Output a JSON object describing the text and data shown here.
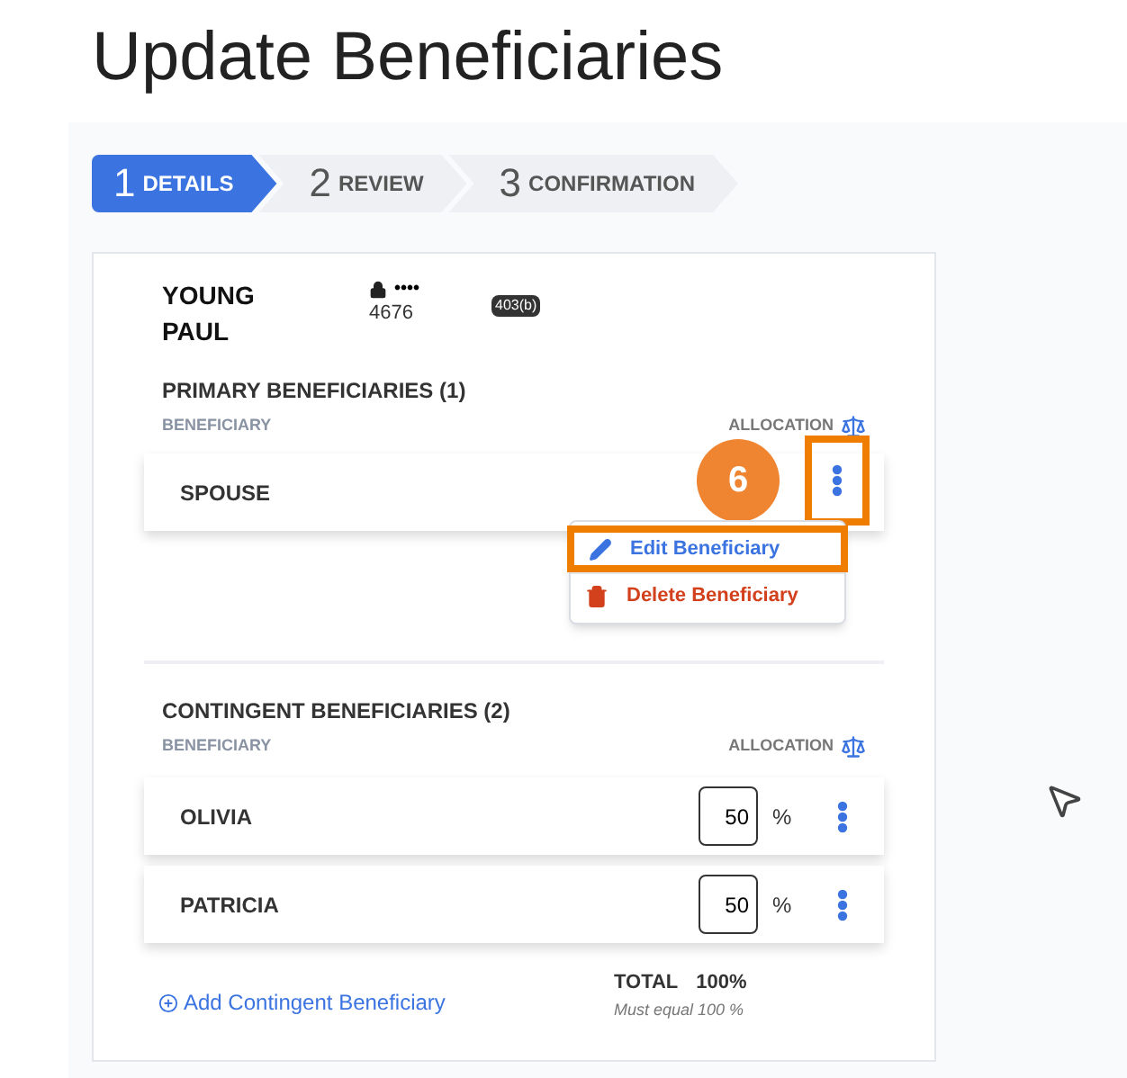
{
  "title": "Update Beneficiaries",
  "steps": [
    {
      "number": "1",
      "label": "DETAILS",
      "selected": true
    },
    {
      "number": "2",
      "label": "REVIEW",
      "selected": false
    },
    {
      "number": "3",
      "label": "CONFIRMATION",
      "selected": false
    }
  ],
  "participant": {
    "last_name": "YOUNG",
    "first_name": "PAUL",
    "masked": "••••",
    "account_suffix": "4676",
    "plan_type": "403(b)"
  },
  "primary": {
    "heading": "PRIMARY BENEFICIARIES (1)",
    "column_1": "BENEFICIARY",
    "column_2": "ALLOCATION",
    "rows": [
      {
        "name": "SPOUSE",
        "menu_highlighted": true
      }
    ],
    "callout": "6",
    "menu": [
      {
        "kind": "edit",
        "label": "Edit Beneficiary",
        "highlighted": true
      },
      {
        "kind": "delete",
        "label": "Delete Beneficiary",
        "highlighted": false
      }
    ]
  },
  "contingent": {
    "heading": "CONTINGENT BENEFICIARIES (2)",
    "column_1": "BENEFICIARY",
    "column_2": "ALLOCATION",
    "rows": [
      {
        "name": "OLIVIA",
        "allocation": "50",
        "unit": "%"
      },
      {
        "name": "PATRICIA",
        "allocation": "50",
        "unit": "%"
      }
    ],
    "add_link": "Add Contingent Beneficiary",
    "total_label": "TOTAL",
    "total_value": "100%",
    "total_note": "Must equal 100 %"
  }
}
